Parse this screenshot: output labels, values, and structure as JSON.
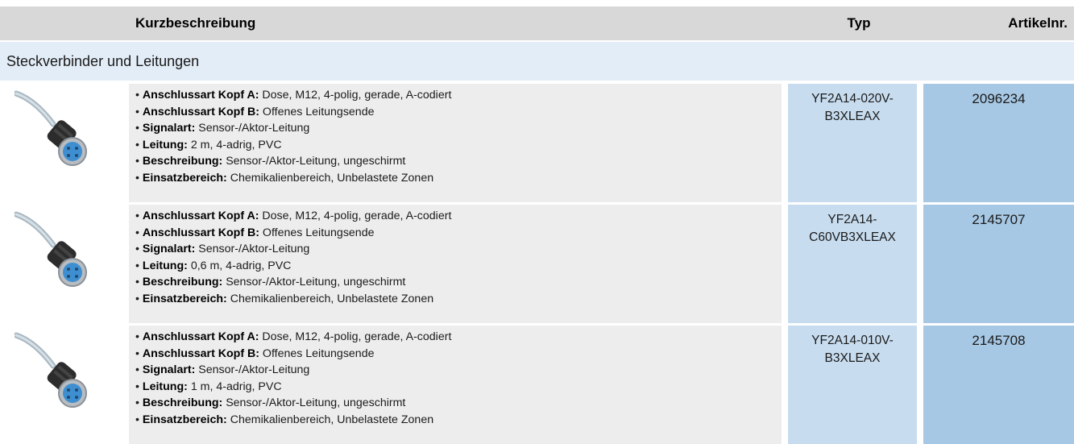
{
  "header": {
    "kurzbeschreibung": "Kurzbeschreibung",
    "typ": "Typ",
    "artikelnr": "Artikelnr."
  },
  "section": {
    "title": "Steckverbinder und Leitungen"
  },
  "products": [
    {
      "image_icon": "cable-connector-icon",
      "specs": [
        {
          "label": "Anschlussart Kopf A:",
          "value": " Dose, M12, 4-polig, gerade, A-codiert"
        },
        {
          "label": "Anschlussart Kopf B:",
          "value": " Offenes Leitungsende"
        },
        {
          "label": "Signalart:",
          "value": " Sensor-/Aktor-Leitung"
        },
        {
          "label": "Leitung:",
          "value": " 2 m, 4-adrig, PVC"
        },
        {
          "label": "Beschreibung:",
          "value": " Sensor-/Aktor-Leitung, ungeschirmt"
        },
        {
          "label": "Einsatzbereich:",
          "value": " Chemikalienbereich, Unbelastete Zonen"
        }
      ],
      "typ_line1": "YF2A14-020V-",
      "typ_line2": "B3XLEAX",
      "artikelnr": "2096234"
    },
    {
      "image_icon": "cable-connector-icon",
      "specs": [
        {
          "label": "Anschlussart Kopf A:",
          "value": " Dose, M12, 4-polig, gerade, A-codiert"
        },
        {
          "label": "Anschlussart Kopf B:",
          "value": " Offenes Leitungsende"
        },
        {
          "label": "Signalart:",
          "value": " Sensor-/Aktor-Leitung"
        },
        {
          "label": "Leitung:",
          "value": " 0,6 m, 4-adrig, PVC"
        },
        {
          "label": "Beschreibung:",
          "value": " Sensor-/Aktor-Leitung, ungeschirmt"
        },
        {
          "label": "Einsatzbereich:",
          "value": " Chemikalienbereich, Unbelastete Zonen"
        }
      ],
      "typ_line1": "YF2A14-",
      "typ_line2": "C60VB3XLEAX",
      "artikelnr": "2145707"
    },
    {
      "image_icon": "cable-connector-icon",
      "specs": [
        {
          "label": "Anschlussart Kopf A:",
          "value": " Dose, M12, 4-polig, gerade, A-codiert"
        },
        {
          "label": "Anschlussart Kopf B:",
          "value": " Offenes Leitungsende"
        },
        {
          "label": "Signalart:",
          "value": " Sensor-/Aktor-Leitung"
        },
        {
          "label": "Leitung:",
          "value": " 1 m, 4-adrig, PVC"
        },
        {
          "label": "Beschreibung:",
          "value": " Sensor-/Aktor-Leitung, ungeschirmt"
        },
        {
          "label": "Einsatzbereich:",
          "value": " Chemikalienbereich, Unbelastete Zonen"
        }
      ],
      "typ_line1": "YF2A14-010V-",
      "typ_line2": "B3XLEAX",
      "artikelnr": "2145708"
    }
  ],
  "colors": {
    "header_bg": "#d8d8d8",
    "section_bg": "#e3edf7",
    "desc_bg": "#ededed",
    "typ_bg": "#c7dcef",
    "art_bg": "#a7c8e4"
  }
}
